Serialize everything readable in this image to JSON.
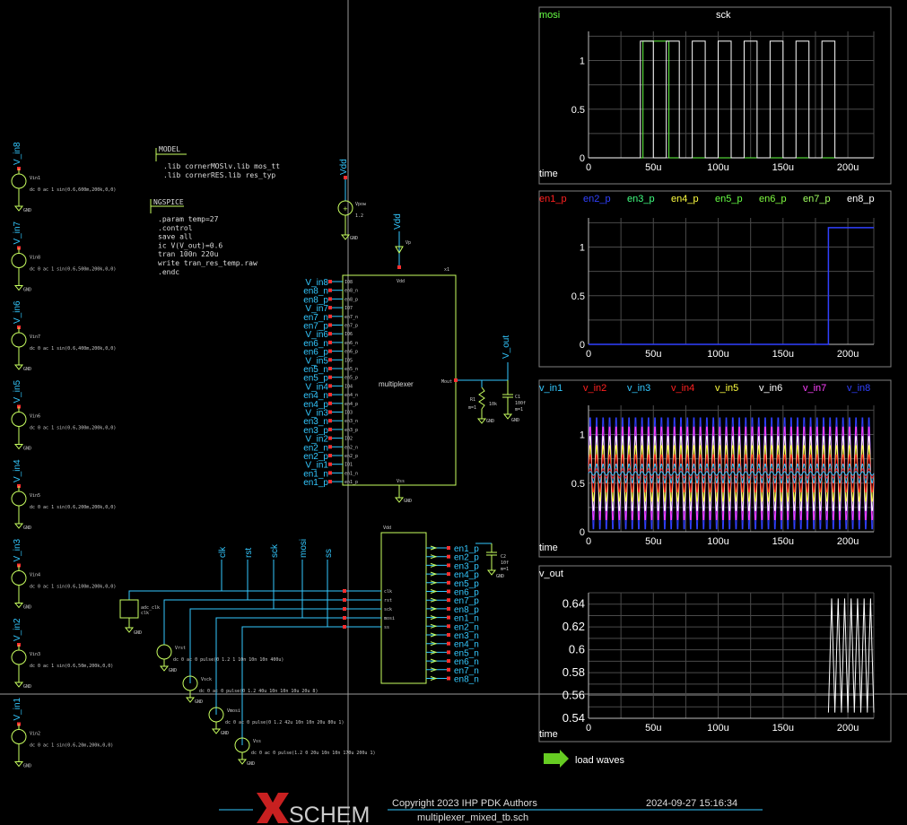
{
  "colors": {
    "background": "#000000",
    "wire": "#33c8ff",
    "symbol": "#c8ff60",
    "text": "#ffffff",
    "grid": "#505050",
    "frame": "#808080"
  },
  "netlist_blocks": {
    "model_title": "MODEL",
    "model_lines": [
      ".lib cornerMOSlv.lib mos_tt",
      ".lib cornerRES.lib res_typ"
    ],
    "ngspice_title": "NGSPICE",
    "ngspice_lines": [
      ".param temp=27",
      ".control",
      "save all",
      "ic V(V_out)=0.6",
      "tran 100n 220u",
      "write tran_res_temp.raw",
      ".endc"
    ]
  },
  "sources": [
    {
      "net": "V_in8",
      "name": "Vin1",
      "value": "dc 0 ac 1 sin(0.6,600m,200k,0,0)"
    },
    {
      "net": "V_in7",
      "name": "Vin8",
      "value": "dc 0 ac 1 sin(0.6,500m,200k,0,0)"
    },
    {
      "net": "V_in6",
      "name": "Vin7",
      "value": "dc 0 ac 1 sin(0.6,400m,200k,0,0)"
    },
    {
      "net": "V_in5",
      "name": "Vin6",
      "value": "dc 0 ac 1 sin(0.6,300m,200k,0,0)"
    },
    {
      "net": "V_in4",
      "name": "Vin5",
      "value": "dc 0 ac 1 sin(0.6,200m,200k,0,0)"
    },
    {
      "net": "V_in3",
      "name": "Vin4",
      "value": "dc 0 ac 1 sin(0.6,100m,200k,0,0)"
    },
    {
      "net": "V_in2",
      "name": "Vin3",
      "value": "dc 0 ac 1 sin(0.6,50m,200k,0,0)"
    },
    {
      "net": "V_in1",
      "name": "Vin2",
      "value": "dc 0 ac 1 sin(0.6,20m,200k,0,0)"
    }
  ],
  "gnd_label": "GND",
  "vdd_label": "Vdd",
  "vpow": {
    "name": "Vpow",
    "value": "1.2"
  },
  "vp_label": "Vp",
  "mux": {
    "name": "multiplexer",
    "instance": "x1",
    "vdd_pin": "Vdd",
    "vss_pin": "Vss",
    "out_pin": "Mout",
    "left_nets": [
      "V_in8",
      "en8_n",
      "en8_p",
      "V_in7",
      "en7_n",
      "en7_p",
      "V_in6",
      "en6_n",
      "en6_p",
      "V_in5",
      "en5_n",
      "en5_p",
      "V_in4",
      "en4_n",
      "en4_p",
      "V_in3",
      "en3_n",
      "en3_p",
      "V_in2",
      "en2_n",
      "en2_p",
      "V_in1",
      "en1_n",
      "en1_p"
    ],
    "left_pins": [
      "IO8",
      "en8_n",
      "en8_p",
      "IO7",
      "en7_n",
      "en7_p",
      "IO6",
      "en6_n",
      "en6_p",
      "IO5",
      "en5_n",
      "en5_p",
      "IO4",
      "en4_n",
      "en4_p",
      "IO3",
      "en3_n",
      "en3_p",
      "IO2",
      "en2_n",
      "en2_p",
      "IO1",
      "en1_n",
      "en1_p"
    ]
  },
  "vout_label": "V_out",
  "r1": {
    "name": "R1",
    "value": "10k",
    "extra": "m=1"
  },
  "c1": {
    "name": "C1",
    "value": "100f",
    "extra": "m=1"
  },
  "c2": {
    "name": "C2",
    "value": "10f",
    "extra": "m=1"
  },
  "spi_inputs": [
    "clk",
    "rst",
    "sck",
    "mosi",
    "ss"
  ],
  "spi_pins": [
    "clk",
    "rst",
    "sck",
    "mosi",
    "ss"
  ],
  "spi_out_nets": [
    "en1_p",
    "en2_p",
    "en3_p",
    "en4_p",
    "en5_p",
    "en6_p",
    "en7_p",
    "en8_p",
    "en1_n",
    "en2_n",
    "en3_n",
    "en4_n",
    "en5_n",
    "en6_n",
    "en7_n",
    "en8_n"
  ],
  "digital_sources": [
    {
      "name": "Vrst",
      "value": "dc 0 ac 0 pulse(0 1.2 1 10n 10n 10n 400u)"
    },
    {
      "name": "Vsck",
      "value": "dc 0 ac 0 pulse(0 1.2 40u 10n 10n 10u 20u 8)"
    },
    {
      "name": "Vmosi",
      "value": "dc 0 ac 0 pulse(0 1.2 42u 10n 10n 20u 80u 1)"
    },
    {
      "name": "Vss",
      "value": "dc 0 ac 0 pulse(1.2 0 20u 10n 10n 170u 200u 1)"
    }
  ],
  "clk_gen": {
    "name": "adc_clk",
    "value": "clk"
  },
  "plots": {
    "p1": {
      "legend": [
        {
          "name": "mosi",
          "color": "#66ff44"
        },
        {
          "name": "sck",
          "color": "#ffffff"
        }
      ],
      "yticks": [
        "1",
        "0.5",
        "0"
      ],
      "xticks": [
        "0",
        "50u",
        "100u",
        "150u",
        "200u"
      ],
      "xlabel": "time"
    },
    "p2": {
      "legend": [
        {
          "name": "en1_p",
          "color": "#ff2020"
        },
        {
          "name": "en2_p",
          "color": "#3040ff"
        },
        {
          "name": "en3_p",
          "color": "#40ff80"
        },
        {
          "name": "en4_p",
          "color": "#ffff40"
        },
        {
          "name": "en5_p",
          "color": "#66ff44"
        },
        {
          "name": "en6_p",
          "color": "#80ff40"
        },
        {
          "name": "en7_p",
          "color": "#a0ff60"
        },
        {
          "name": "en8_p",
          "color": "#ffffff"
        }
      ],
      "yticks": [
        "1",
        "0.5",
        "0"
      ],
      "xticks": [
        "0",
        "50u",
        "100u",
        "150u",
        "200u"
      ],
      "xlabel": ""
    },
    "p3": {
      "legend": [
        {
          "name": "v_in1",
          "color": "#33c8ff"
        },
        {
          "name": "v_in2",
          "color": "#ff2020"
        },
        {
          "name": "v_in3",
          "color": "#33c8ff"
        },
        {
          "name": "v_in4",
          "color": "#ff2020"
        },
        {
          "name": "v_in5",
          "color": "#ffff40"
        },
        {
          "name": "v_in6",
          "color": "#ffffff"
        },
        {
          "name": "v_in7",
          "color": "#ff40ff"
        },
        {
          "name": "v_in8",
          "color": "#3040ff"
        }
      ],
      "yticks": [
        "1",
        "0.5",
        "0"
      ],
      "xticks": [
        "0",
        "50u",
        "100u",
        "150u",
        "200u"
      ],
      "xlabel": "time"
    },
    "p4": {
      "legend": [
        {
          "name": "v_out",
          "color": "#ffffff"
        }
      ],
      "yticks": [
        "0.64",
        "0.62",
        "0.6",
        "0.58",
        "0.56",
        "0.54"
      ],
      "xticks": [
        "0",
        "50u",
        "100u",
        "150u",
        "200u"
      ],
      "xlabel": "time"
    }
  },
  "chart_data": [
    {
      "type": "line",
      "title": "",
      "xlabel": "time",
      "x_range": [
        "0",
        "220u"
      ],
      "ylim": [
        0,
        1.3
      ],
      "series": [
        {
          "name": "mosi",
          "description_points": [
            [
              0,
              0
            ],
            [
              42,
              0
            ],
            [
              42,
              1.2
            ],
            [
              62,
              1.2
            ],
            [
              62,
              0
            ],
            [
              220,
              0
            ]
          ]
        },
        {
          "name": "sck",
          "description_points": [
            [
              0,
              0
            ],
            [
              40,
              0
            ],
            [
              40,
              1.2
            ],
            [
              50,
              1.2
            ],
            [
              50,
              0
            ],
            [
              60,
              0
            ],
            [
              60,
              1.2
            ],
            [
              70,
              1.2
            ],
            [
              70,
              0
            ],
            [
              80,
              0
            ],
            [
              80,
              1.2
            ],
            [
              90,
              1.2
            ],
            [
              90,
              0
            ],
            [
              100,
              0
            ],
            [
              100,
              1.2
            ],
            [
              110,
              1.2
            ],
            [
              110,
              0
            ],
            [
              120,
              0
            ],
            [
              120,
              1.2
            ],
            [
              130,
              1.2
            ],
            [
              130,
              0
            ],
            [
              140,
              0
            ],
            [
              140,
              1.2
            ],
            [
              150,
              1.2
            ],
            [
              150,
              0
            ],
            [
              160,
              0
            ],
            [
              160,
              1.2
            ],
            [
              170,
              1.2
            ],
            [
              170,
              0
            ],
            [
              180,
              0
            ],
            [
              180,
              1.2
            ],
            [
              190,
              1.2
            ],
            [
              190,
              0
            ],
            [
              220,
              0
            ]
          ]
        }
      ]
    },
    {
      "type": "line",
      "title": "",
      "x_range": [
        "0",
        "220u"
      ],
      "ylim": [
        0,
        1.3
      ],
      "series": [
        {
          "name": "en8_p",
          "description_points": [
            [
              0,
              0
            ],
            [
              185,
              0
            ],
            [
              185,
              1.2
            ],
            [
              220,
              1.2
            ]
          ]
        }
      ]
    },
    {
      "type": "line",
      "title": "",
      "xlabel": "time",
      "x_range": [
        "0",
        "220u"
      ],
      "ylim": [
        0,
        1.3
      ],
      "series": [
        {
          "name": "v_in1",
          "amplitude": 0.02,
          "offset": 0.6
        },
        {
          "name": "v_in2",
          "amplitude": 0.05,
          "offset": 0.6
        },
        {
          "name": "v_in3",
          "amplitude": 0.1,
          "offset": 0.6
        },
        {
          "name": "v_in4",
          "amplitude": 0.2,
          "offset": 0.6
        },
        {
          "name": "v_in5",
          "amplitude": 0.3,
          "offset": 0.6
        },
        {
          "name": "v_in6",
          "amplitude": 0.4,
          "offset": 0.6
        },
        {
          "name": "v_in7",
          "amplitude": 0.5,
          "offset": 0.6
        },
        {
          "name": "v_in8",
          "amplitude": 0.6,
          "offset": 0.6
        }
      ]
    },
    {
      "type": "line",
      "title": "",
      "xlabel": "time",
      "x_range": [
        "0",
        "220u"
      ],
      "ylim": [
        0.54,
        0.65
      ],
      "series": [
        {
          "name": "v_out",
          "start": 185,
          "low": 0.545,
          "high": 0.645
        }
      ]
    }
  ],
  "load_waves": "load waves",
  "footer": {
    "logo": "SCHEM",
    "copyright": "Copyright 2023 IHP PDK Authors",
    "filename": "multiplexer_mixed_tb.sch",
    "date": "2024-09-27  15:16:34"
  }
}
